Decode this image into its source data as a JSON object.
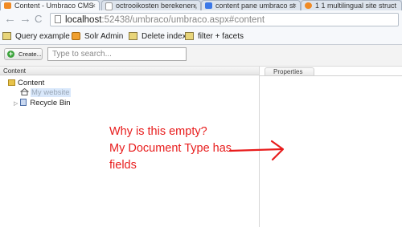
{
  "browser": {
    "tabs": [
      {
        "label": "Content - Umbraco CMS",
        "active": true,
        "icon": "umbraco-orange-icon"
      },
      {
        "label": "octrooikosten berekenen,",
        "active": false,
        "icon": "page-icon"
      },
      {
        "label": "content pane umbraco st",
        "active": false,
        "icon": "google-icon"
      },
      {
        "label": "1 1 multilingual site struct",
        "active": false,
        "icon": "umbraco-orange-icon"
      }
    ],
    "url_host": "localhost",
    "url_rest": ":52438/umbraco/umbraco.aspx#content",
    "bookmarks": [
      "Query example",
      "Solr Admin",
      "Delete index",
      "filter + facets"
    ]
  },
  "umbraco": {
    "create_label": "Create...",
    "search_placeholder": "Type to search...",
    "tree_header": "Content",
    "tree": {
      "root": "Content",
      "child": "My website",
      "recycle": "Recycle Bin"
    },
    "properties_tab": "Properties"
  },
  "annotation": {
    "line1": "Why is this empty?",
    "line2": "My Document Type has",
    "line3": "fields",
    "color": "#e81c1c"
  }
}
